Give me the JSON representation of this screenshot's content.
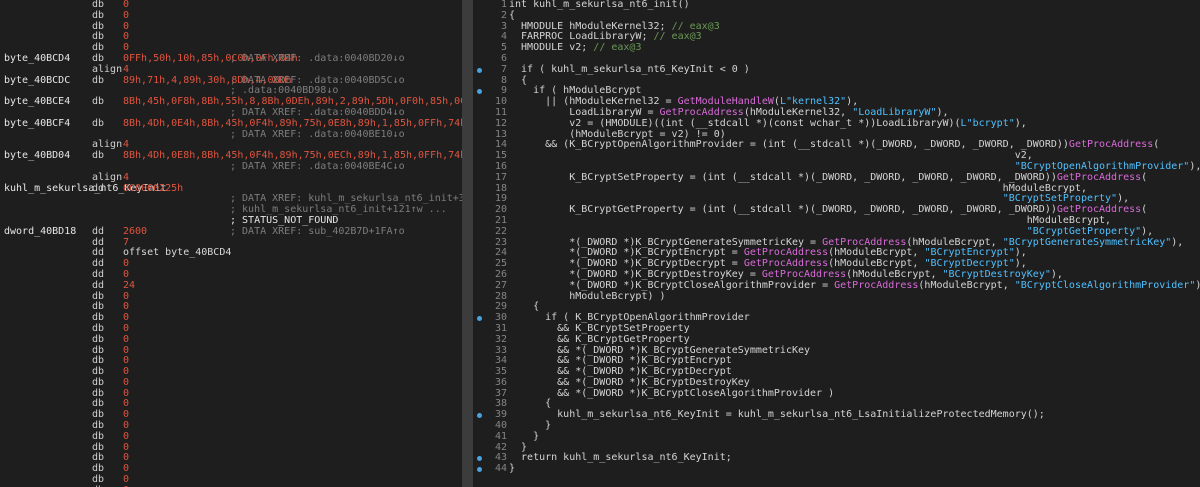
{
  "left_pane": {
    "lines": [
      {
        "label": "",
        "op": "db",
        "val": "0",
        "cmt": ""
      },
      {
        "label": "",
        "op": "db",
        "val": "0",
        "cmt": ""
      },
      {
        "label": "",
        "op": "db",
        "val": "0",
        "cmt": ""
      },
      {
        "label": "",
        "op": "db",
        "val": "0",
        "cmt": ""
      },
      {
        "label": "",
        "op": "db",
        "val": "0",
        "cmt": ""
      },
      {
        "label": "byte_40BCD4",
        "op": "db",
        "val": "0FFh,50h,10h,85h,0C0h,0Fh,84h",
        "cmt": "; DATA XREF: .data:0040BD20↓o"
      },
      {
        "label": "",
        "op": "align",
        "val": "4",
        "cmt": ""
      },
      {
        "label": "byte_40BCDC",
        "op": "db",
        "val": "89h,71h,4,89h,30h,8Dh,4,0BDh",
        "cmt": "; DATA XREF: .data:0040BD5C↓o"
      },
      {
        "label": "",
        "op": "",
        "val": "",
        "cmt": "; .data:0040BD98↓o"
      },
      {
        "label": "byte_40BCE4",
        "op": "db",
        "val": "8Bh,45h,0F8h,8Bh,55h,8,8Bh,0DEh,89h,2,89h,5Dh,0F0h,85h,0C9h,74h",
        "cmt": ""
      },
      {
        "label": "",
        "op": "",
        "val": "",
        "cmt": "; DATA XREF: .data:0040BDD4↓o"
      },
      {
        "label": "byte_40BCF4",
        "op": "db",
        "val": "8Bh,4Dh,0E4h,8Bh,45h,0F4h,89h,75h,0E8h,89h,1,85h,0FFh,74h",
        "cmt": ""
      },
      {
        "label": "",
        "op": "",
        "val": "",
        "cmt": "; DATA XREF: .data:0040BE10↓o"
      },
      {
        "label": "",
        "op": "align",
        "val": "4",
        "cmt": ""
      },
      {
        "label": "byte_40BD04",
        "op": "db",
        "val": "8Bh,4Dh,0E8h,8Bh,45h,0F4h,89h,75h,0ECh,89h,1,85h,0FFh,74h",
        "cmt": ""
      },
      {
        "label": "",
        "op": "",
        "val": "",
        "cmt": "; DATA XREF: .data:0040BE4C↓o"
      },
      {
        "label": "",
        "op": "align",
        "val": "4",
        "cmt": ""
      },
      {
        "label": "kuhl_m_sekurlsa_nt6_KeyInit",
        "op": "dd",
        "val": "0C0000225h",
        "cmt": ""
      },
      {
        "label": "",
        "op": "",
        "val": "",
        "cmt": "; DATA XREF: kuhl_m_sekurlsa_nt6_init+3↑r"
      },
      {
        "label": "",
        "op": "",
        "val": "",
        "cmt": "; kuhl_m_sekurlsa_nt6_init+121↑w ..."
      },
      {
        "label": "",
        "op": "",
        "val": "",
        "cmt": "; STATUS_NOT_FOUND"
      },
      {
        "label": "dword_40BD18",
        "op": "dd",
        "val": "2600",
        "cmt": "; DATA XREF: sub_402B7D+1FA↑o"
      },
      {
        "label": "",
        "op": "dd",
        "val": "7",
        "cmt": ""
      },
      {
        "label": "",
        "op": "dd",
        "val": "offset byte_40BCD4",
        "cmt": ""
      },
      {
        "label": "",
        "op": "dd",
        "val": "0",
        "cmt": ""
      },
      {
        "label": "",
        "op": "dd",
        "val": "0",
        "cmt": ""
      },
      {
        "label": "",
        "op": "dd",
        "val": "24",
        "cmt": ""
      },
      {
        "label": "",
        "op": "db",
        "val": "0",
        "cmt": ""
      },
      {
        "label": "",
        "op": "db",
        "val": "0",
        "cmt": ""
      },
      {
        "label": "",
        "op": "db",
        "val": "0",
        "cmt": ""
      },
      {
        "label": "",
        "op": "db",
        "val": "0",
        "cmt": ""
      },
      {
        "label": "",
        "op": "db",
        "val": "0",
        "cmt": ""
      },
      {
        "label": "",
        "op": "db",
        "val": "0",
        "cmt": ""
      },
      {
        "label": "",
        "op": "db",
        "val": "0",
        "cmt": ""
      },
      {
        "label": "",
        "op": "db",
        "val": "0",
        "cmt": ""
      },
      {
        "label": "",
        "op": "db",
        "val": "0",
        "cmt": ""
      },
      {
        "label": "",
        "op": "db",
        "val": "0",
        "cmt": ""
      },
      {
        "label": "",
        "op": "db",
        "val": "0",
        "cmt": ""
      },
      {
        "label": "",
        "op": "db",
        "val": "0",
        "cmt": ""
      },
      {
        "label": "",
        "op": "db",
        "val": "0",
        "cmt": ""
      },
      {
        "label": "",
        "op": "db",
        "val": "0",
        "cmt": ""
      },
      {
        "label": "",
        "op": "db",
        "val": "0",
        "cmt": ""
      },
      {
        "label": "",
        "op": "db",
        "val": "0",
        "cmt": ""
      },
      {
        "label": "",
        "op": "db",
        "val": "0",
        "cmt": ""
      },
      {
        "label": "",
        "op": "db",
        "val": "0",
        "cmt": ""
      },
      {
        "label": "",
        "op": "db",
        "val": "0",
        "cmt": ""
      }
    ]
  },
  "right_pane": {
    "lines": [
      {
        "n": "1",
        "dot": false,
        "tokens": [
          [
            "id",
            "int kuhl_m_sekurlsa_nt6_init()"
          ]
        ]
      },
      {
        "n": "2",
        "dot": false,
        "tokens": [
          [
            "id",
            "{"
          ]
        ]
      },
      {
        "n": "3",
        "dot": false,
        "tokens": [
          [
            "id",
            "  HMODULE hModuleKernel32; "
          ],
          [
            "cm",
            "// eax@3"
          ]
        ]
      },
      {
        "n": "4",
        "dot": false,
        "tokens": [
          [
            "id",
            "  FARPROC LoadLibraryW; "
          ],
          [
            "cm",
            "// eax@3"
          ]
        ]
      },
      {
        "n": "5",
        "dot": false,
        "tokens": [
          [
            "id",
            "  HMODULE v2; "
          ],
          [
            "cm",
            "// eax@3"
          ]
        ]
      },
      {
        "n": "6",
        "dot": false,
        "tokens": [
          [
            "id",
            ""
          ]
        ]
      },
      {
        "n": "7",
        "dot": true,
        "tokens": [
          [
            "id",
            "  if ( kuhl_m_sekurlsa_nt6_KeyInit < 0 )"
          ]
        ]
      },
      {
        "n": "8",
        "dot": false,
        "tokens": [
          [
            "id",
            "  {"
          ]
        ]
      },
      {
        "n": "9",
        "dot": true,
        "tokens": [
          [
            "id",
            "    if ( hModuleBcrypt"
          ]
        ]
      },
      {
        "n": "10",
        "dot": false,
        "tokens": [
          [
            "id",
            "      || (hModuleKernel32 = "
          ],
          [
            "fn",
            "GetModuleHandleW"
          ],
          [
            "id",
            "("
          ],
          [
            "str",
            "L\"kernel32\""
          ],
          [
            "id",
            "),"
          ]
        ]
      },
      {
        "n": "11",
        "dot": false,
        "tokens": [
          [
            "id",
            "          LoadLibraryW = "
          ],
          [
            "fn",
            "GetProcAddress"
          ],
          [
            "id",
            "(hModuleKernel32, "
          ],
          [
            "str",
            "\"LoadLibraryW\""
          ],
          [
            "id",
            "),"
          ]
        ]
      },
      {
        "n": "12",
        "dot": false,
        "tokens": [
          [
            "id",
            "          v2 = (HMODULE)((int (__stdcall *)(const wchar_t *))LoadLibraryW)("
          ],
          [
            "str",
            "L\"bcrypt\""
          ],
          [
            "id",
            "),"
          ]
        ]
      },
      {
        "n": "13",
        "dot": false,
        "tokens": [
          [
            "id",
            "          (hModuleBcrypt = v2) != 0)"
          ]
        ]
      },
      {
        "n": "14",
        "dot": false,
        "tokens": [
          [
            "id",
            "      && (K_BCryptOpenAlgorithmProvider = (int (__stdcall *)(_DWORD, _DWORD, _DWORD, _DWORD))"
          ],
          [
            "fn",
            "GetProcAddress"
          ],
          [
            "id",
            "("
          ]
        ]
      },
      {
        "n": "15",
        "dot": false,
        "tokens": [
          [
            "id",
            "                                                                                    v2,"
          ]
        ]
      },
      {
        "n": "16",
        "dot": false,
        "tokens": [
          [
            "id",
            "                                                                                    "
          ],
          [
            "str",
            "\"BCryptOpenAlgorithmProvider\""
          ],
          [
            "id",
            "),"
          ]
        ]
      },
      {
        "n": "17",
        "dot": false,
        "tokens": [
          [
            "id",
            "          K_BCryptSetProperty = (int (__stdcall *)(_DWORD, _DWORD, _DWORD, _DWORD, _DWORD))"
          ],
          [
            "fn",
            "GetProcAddress"
          ],
          [
            "id",
            "("
          ]
        ]
      },
      {
        "n": "18",
        "dot": false,
        "tokens": [
          [
            "id",
            "                                                                                  hModuleBcrypt,"
          ]
        ]
      },
      {
        "n": "19",
        "dot": false,
        "tokens": [
          [
            "id",
            "                                                                                  "
          ],
          [
            "str",
            "\"BCryptSetProperty\""
          ],
          [
            "id",
            "),"
          ]
        ]
      },
      {
        "n": "20",
        "dot": false,
        "tokens": [
          [
            "id",
            "          K_BCryptGetProperty = (int (__stdcall *)(_DWORD, _DWORD, _DWORD, _DWORD, _DWORD))"
          ],
          [
            "fn",
            "GetProcAddress"
          ],
          [
            "id",
            "("
          ]
        ]
      },
      {
        "n": "21",
        "dot": false,
        "tokens": [
          [
            "id",
            "                                                                                      hModuleBcrypt,"
          ]
        ]
      },
      {
        "n": "22",
        "dot": false,
        "tokens": [
          [
            "id",
            "                                                                                      "
          ],
          [
            "str",
            "\"BCryptGetProperty\""
          ],
          [
            "id",
            "),"
          ]
        ]
      },
      {
        "n": "23",
        "dot": false,
        "tokens": [
          [
            "id",
            "          *(_DWORD *)K_BCryptGenerateSymmetricKey = "
          ],
          [
            "fn",
            "GetProcAddress"
          ],
          [
            "id",
            "(hModuleBcrypt, "
          ],
          [
            "str",
            "\"BCryptGenerateSymmetricKey\""
          ],
          [
            "id",
            "),"
          ]
        ]
      },
      {
        "n": "24",
        "dot": false,
        "tokens": [
          [
            "id",
            "          *(_DWORD *)K_BCryptEncrypt = "
          ],
          [
            "fn",
            "GetProcAddress"
          ],
          [
            "id",
            "(hModuleBcrypt, "
          ],
          [
            "str",
            "\"BCryptEncrypt\""
          ],
          [
            "id",
            "),"
          ]
        ]
      },
      {
        "n": "25",
        "dot": false,
        "tokens": [
          [
            "id",
            "          *(_DWORD *)K_BCryptDecrypt = "
          ],
          [
            "fn",
            "GetProcAddress"
          ],
          [
            "id",
            "(hModuleBcrypt, "
          ],
          [
            "str",
            "\"BCryptDecrypt\""
          ],
          [
            "id",
            "),"
          ]
        ]
      },
      {
        "n": "26",
        "dot": false,
        "tokens": [
          [
            "id",
            "          *(_DWORD *)K_BCryptDestroyKey = "
          ],
          [
            "fn",
            "GetProcAddress"
          ],
          [
            "id",
            "(hModuleBcrypt, "
          ],
          [
            "str",
            "\"BCryptDestroyKey\""
          ],
          [
            "id",
            "),"
          ]
        ]
      },
      {
        "n": "27",
        "dot": false,
        "tokens": [
          [
            "id",
            "          *(_DWORD *)K_BCryptCloseAlgorithmProvider = "
          ],
          [
            "fn",
            "GetProcAddress"
          ],
          [
            "id",
            "(hModuleBcrypt, "
          ],
          [
            "str",
            "\"BCryptCloseAlgorithmProvider\""
          ],
          [
            "id",
            "),"
          ]
        ]
      },
      {
        "n": "28",
        "dot": false,
        "tokens": [
          [
            "id",
            "          hModuleBcrypt) )"
          ]
        ]
      },
      {
        "n": "29",
        "dot": false,
        "tokens": [
          [
            "id",
            "    {"
          ]
        ]
      },
      {
        "n": "30",
        "dot": true,
        "tokens": [
          [
            "id",
            "      if ( K_BCryptOpenAlgorithmProvider"
          ]
        ]
      },
      {
        "n": "31",
        "dot": false,
        "tokens": [
          [
            "id",
            "        && K_BCryptSetProperty"
          ]
        ]
      },
      {
        "n": "32",
        "dot": false,
        "tokens": [
          [
            "id",
            "        && K_BCryptGetProperty"
          ]
        ]
      },
      {
        "n": "33",
        "dot": false,
        "tokens": [
          [
            "id",
            "        && *(_DWORD *)K_BCryptGenerateSymmetricKey"
          ]
        ]
      },
      {
        "n": "34",
        "dot": false,
        "tokens": [
          [
            "id",
            "        && *(_DWORD *)K_BCryptEncrypt"
          ]
        ]
      },
      {
        "n": "35",
        "dot": false,
        "tokens": [
          [
            "id",
            "        && *(_DWORD *)K_BCryptDecrypt"
          ]
        ]
      },
      {
        "n": "36",
        "dot": false,
        "tokens": [
          [
            "id",
            "        && *(_DWORD *)K_BCryptDestroyKey"
          ]
        ]
      },
      {
        "n": "37",
        "dot": false,
        "tokens": [
          [
            "id",
            "        && *(_DWORD *)K_BCryptCloseAlgorithmProvider )"
          ]
        ]
      },
      {
        "n": "38",
        "dot": false,
        "tokens": [
          [
            "id",
            "      {"
          ]
        ]
      },
      {
        "n": "39",
        "dot": true,
        "tokens": [
          [
            "id",
            "        kuhl_m_sekurlsa_nt6_KeyInit = kuhl_m_sekurlsa_nt6_LsaInitializeProtectedMemory();"
          ]
        ]
      },
      {
        "n": "40",
        "dot": false,
        "tokens": [
          [
            "id",
            "      }"
          ]
        ]
      },
      {
        "n": "41",
        "dot": false,
        "tokens": [
          [
            "id",
            "    }"
          ]
        ]
      },
      {
        "n": "42",
        "dot": false,
        "tokens": [
          [
            "id",
            "  }"
          ]
        ]
      },
      {
        "n": "43",
        "dot": true,
        "tokens": [
          [
            "id",
            "  return kuhl_m_sekurlsa_nt6_KeyInit;"
          ]
        ]
      },
      {
        "n": "44",
        "dot": true,
        "tokens": [
          [
            "id",
            "}"
          ]
        ]
      }
    ]
  }
}
